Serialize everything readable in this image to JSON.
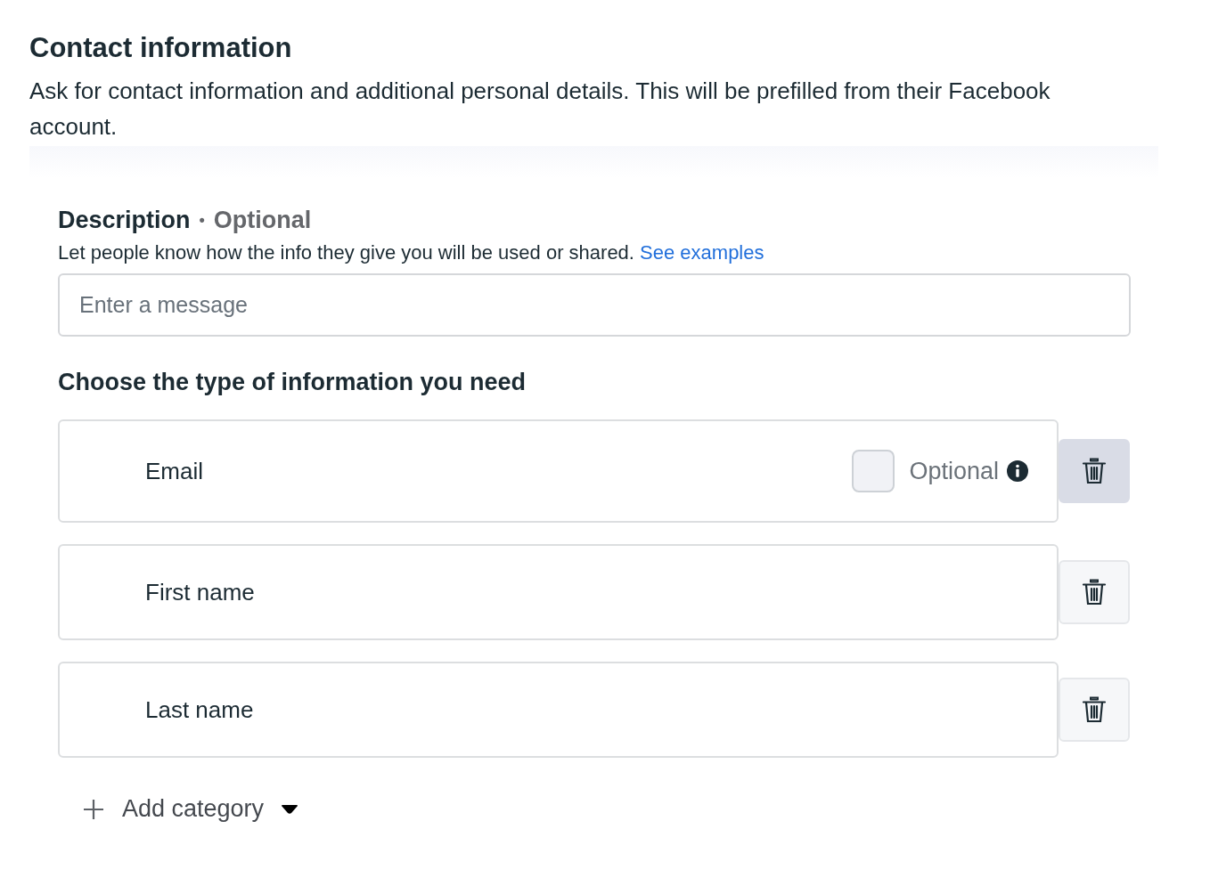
{
  "header": {
    "title": "Contact information",
    "subtitle": "Ask for contact information and additional personal details. This will be prefilled from their Facebook account."
  },
  "description": {
    "label": "Description",
    "separator": "•",
    "optional_label": "Optional",
    "help": "Let people know how the info they give you will be used or shared.",
    "link": "See examples",
    "placeholder": "Enter a message"
  },
  "info_types": {
    "heading": "Choose the type of information you need",
    "items": [
      {
        "label": "Email",
        "optional": {
          "label": "Optional",
          "checked": false
        },
        "delete_highlighted": true
      },
      {
        "label": "First name",
        "delete_highlighted": false
      },
      {
        "label": "Last name",
        "delete_highlighted": false
      }
    ]
  },
  "add_category": {
    "label": "Add category"
  }
}
